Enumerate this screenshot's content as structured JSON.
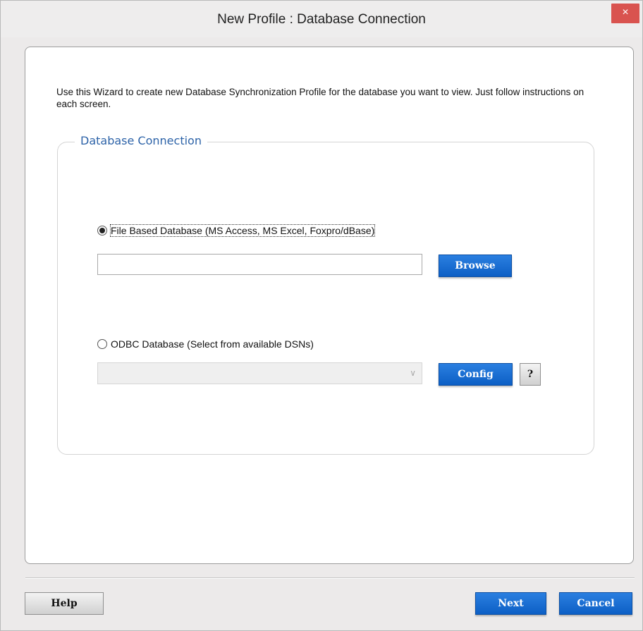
{
  "window": {
    "title": "New Profile : Database Connection",
    "close_glyph": "×"
  },
  "intro_text": "Use this Wizard to create new Database Synchronization Profile for the database you want to view. Just follow instructions on each screen.",
  "group": {
    "legend": "Database Connection",
    "file_option": {
      "label": "File Based Database (MS Access, MS Excel, Foxpro/dBase)",
      "selected": true,
      "path_value": "",
      "browse_label": "Browse"
    },
    "odbc_option": {
      "label": "ODBC Database (Select from available DSNs)",
      "selected": false,
      "dsn_value": "",
      "config_label": "Config",
      "help_label": "?"
    }
  },
  "footer": {
    "help_label": "Help",
    "next_label": "Next",
    "cancel_label": "Cancel"
  },
  "colors": {
    "accent_blue": "#0d5fc5",
    "close_red": "#d9534f",
    "legend_blue": "#2d63a8"
  }
}
